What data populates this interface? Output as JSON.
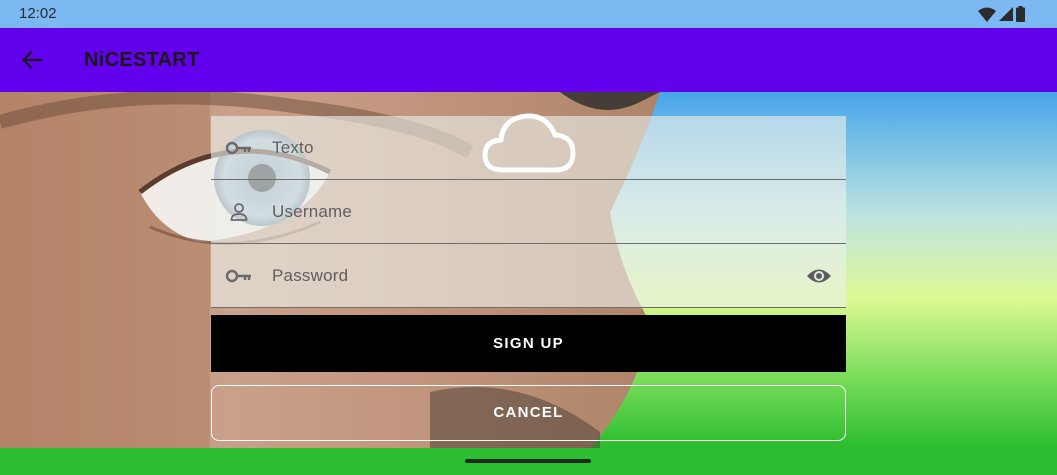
{
  "status_bar": {
    "time": "12:02",
    "icons": [
      "wifi-icon",
      "cell-signal-icon",
      "battery-icon"
    ]
  },
  "app_bar": {
    "title": "NiCESTART",
    "back_icon": "arrow-left-icon",
    "color": "#6200ee"
  },
  "form": {
    "fields": [
      {
        "placeholder": "Texto",
        "icon": "key-icon"
      },
      {
        "placeholder": "Username",
        "icon": "person-icon"
      },
      {
        "placeholder": "Password",
        "icon": "key-icon",
        "trailing_icon": "eye-icon"
      }
    ],
    "overlay_icon": "cloud-icon",
    "signup_label": "SIGN UP",
    "cancel_label": "CANCEL"
  },
  "colors": {
    "status_bar": "#7cb9f3",
    "button_primary": "#000000",
    "bottom_bar": "#2dbd30"
  }
}
